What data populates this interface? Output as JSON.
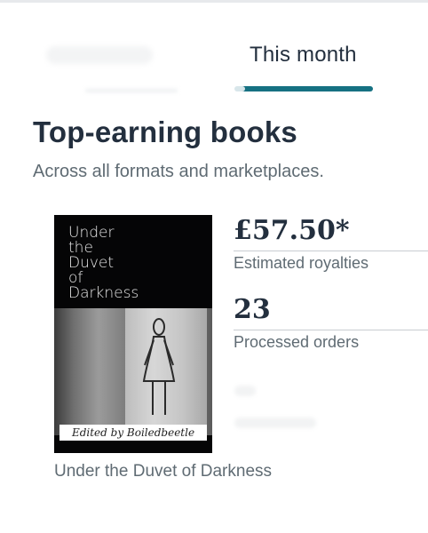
{
  "tabs": {
    "active_label": "This month"
  },
  "section": {
    "title": "Top-earning books",
    "subtitle": "Across all formats and marketplaces."
  },
  "book": {
    "cover_title": "Under\nthe\nDuvet\nof\nDarkness",
    "cover_editor": "Edited by Boiledbeetle",
    "caption": "Under the Duvet of Darkness",
    "royalties": {
      "value": "£57.50*",
      "label": "Estimated royalties"
    },
    "orders": {
      "value": "23",
      "label": "Processed orders"
    }
  },
  "colors": {
    "accent": "#167182",
    "heading": "#232f3e",
    "muted": "#5f6b73"
  }
}
